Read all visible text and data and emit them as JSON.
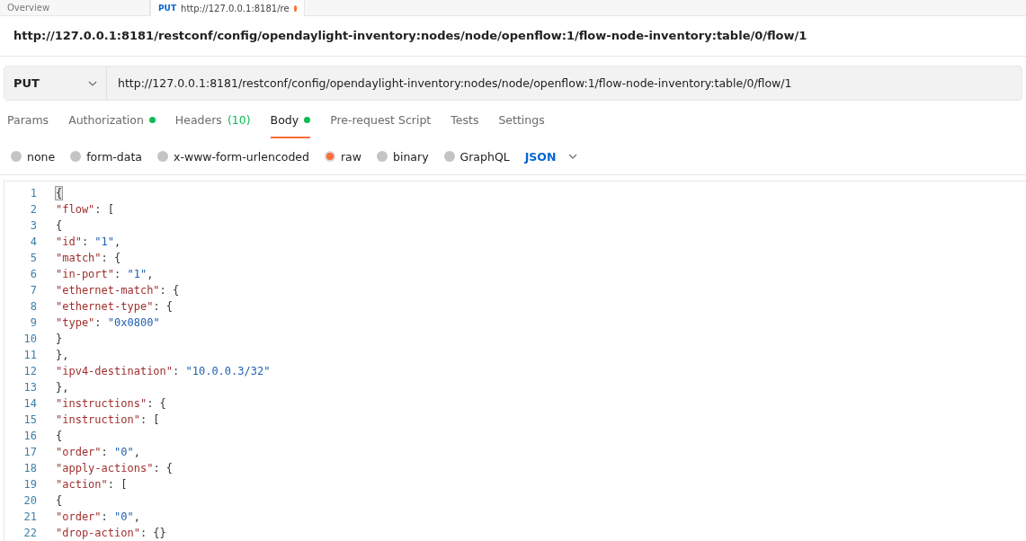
{
  "top_tabs": [
    {
      "label": "Overview",
      "selected": false,
      "unsaved": false
    },
    {
      "label": "http://127.0.0.1:8181/re",
      "method": "PUT",
      "selected": true,
      "unsaved": true
    }
  ],
  "request_title": "http://127.0.0.1:8181/restconf/config/opendaylight-inventory:nodes/node/openflow:1/flow-node-inventory:table/0/flow/1",
  "request_bar": {
    "method": "PUT",
    "url": "http://127.0.0.1:8181/restconf/config/opendaylight-inventory:nodes/node/openflow:1/flow-node-inventory:table/0/flow/1"
  },
  "tabs": [
    {
      "label": "Params",
      "selected": false,
      "dot": false
    },
    {
      "label": "Authorization",
      "selected": false,
      "dot": true
    },
    {
      "label": "Headers",
      "count": "(10)",
      "selected": false,
      "dot": false
    },
    {
      "label": "Body",
      "selected": true,
      "dot": true
    },
    {
      "label": "Pre-request Script",
      "selected": false,
      "dot": false
    },
    {
      "label": "Tests",
      "selected": false,
      "dot": false
    },
    {
      "label": "Settings",
      "selected": false,
      "dot": false
    }
  ],
  "body_types": [
    {
      "label": "none",
      "selected": false
    },
    {
      "label": "form-data",
      "selected": false
    },
    {
      "label": "x-www-form-urlencoded",
      "selected": false
    },
    {
      "label": "raw",
      "selected": true
    },
    {
      "label": "binary",
      "selected": false
    },
    {
      "label": "GraphQL",
      "selected": false
    }
  ],
  "format": "JSON",
  "editor_lines": [
    {
      "number": "1",
      "tokens": [
        {
          "kind": "punct",
          "text": "{",
          "match": true
        }
      ]
    },
    {
      "number": "2",
      "tokens": [
        {
          "kind": "key",
          "text": "\"flow\""
        },
        {
          "kind": "punct",
          "text": ": ["
        }
      ]
    },
    {
      "number": "3",
      "tokens": [
        {
          "kind": "punct",
          "text": "{"
        }
      ]
    },
    {
      "number": "4",
      "tokens": [
        {
          "kind": "key",
          "text": "\"id\""
        },
        {
          "kind": "punct",
          "text": ": "
        },
        {
          "kind": "string",
          "text": "\"1\""
        },
        {
          "kind": "punct",
          "text": ","
        }
      ]
    },
    {
      "number": "5",
      "tokens": [
        {
          "kind": "key",
          "text": "\"match\""
        },
        {
          "kind": "punct",
          "text": ": {"
        }
      ]
    },
    {
      "number": "6",
      "tokens": [
        {
          "kind": "key",
          "text": "\"in-port\""
        },
        {
          "kind": "punct",
          "text": ": "
        },
        {
          "kind": "string",
          "text": "\"1\""
        },
        {
          "kind": "punct",
          "text": ","
        }
      ]
    },
    {
      "number": "7",
      "tokens": [
        {
          "kind": "key",
          "text": "\"ethernet-match\""
        },
        {
          "kind": "punct",
          "text": ": {"
        }
      ]
    },
    {
      "number": "8",
      "tokens": [
        {
          "kind": "key",
          "text": "\"ethernet-type\""
        },
        {
          "kind": "punct",
          "text": ": {"
        }
      ]
    },
    {
      "number": "9",
      "tokens": [
        {
          "kind": "key",
          "text": "\"type\""
        },
        {
          "kind": "punct",
          "text": ": "
        },
        {
          "kind": "string",
          "text": "\"0x0800\""
        }
      ]
    },
    {
      "number": "10",
      "tokens": [
        {
          "kind": "punct",
          "text": "}"
        }
      ]
    },
    {
      "number": "11",
      "tokens": [
        {
          "kind": "punct",
          "text": "},"
        }
      ]
    },
    {
      "number": "12",
      "tokens": [
        {
          "kind": "key",
          "text": "\"ipv4-destination\""
        },
        {
          "kind": "punct",
          "text": ": "
        },
        {
          "kind": "string",
          "text": "\"10.0.0.3/32\""
        }
      ]
    },
    {
      "number": "13",
      "tokens": [
        {
          "kind": "punct",
          "text": "},"
        }
      ]
    },
    {
      "number": "14",
      "tokens": [
        {
          "kind": "key",
          "text": "\"instructions\""
        },
        {
          "kind": "punct",
          "text": ": {"
        }
      ]
    },
    {
      "number": "15",
      "tokens": [
        {
          "kind": "key",
          "text": "\"instruction\""
        },
        {
          "kind": "punct",
          "text": ": ["
        }
      ]
    },
    {
      "number": "16",
      "tokens": [
        {
          "kind": "punct",
          "text": "{"
        }
      ]
    },
    {
      "number": "17",
      "tokens": [
        {
          "kind": "key",
          "text": "\"order\""
        },
        {
          "kind": "punct",
          "text": ": "
        },
        {
          "kind": "string",
          "text": "\"0\""
        },
        {
          "kind": "punct",
          "text": ","
        }
      ]
    },
    {
      "number": "18",
      "tokens": [
        {
          "kind": "key",
          "text": "\"apply-actions\""
        },
        {
          "kind": "punct",
          "text": ": {"
        }
      ]
    },
    {
      "number": "19",
      "tokens": [
        {
          "kind": "key",
          "text": "\"action\""
        },
        {
          "kind": "punct",
          "text": ": ["
        }
      ]
    },
    {
      "number": "20",
      "tokens": [
        {
          "kind": "punct",
          "text": "{"
        }
      ]
    },
    {
      "number": "21",
      "tokens": [
        {
          "kind": "key",
          "text": "\"order\""
        },
        {
          "kind": "punct",
          "text": ": "
        },
        {
          "kind": "string",
          "text": "\"0\""
        },
        {
          "kind": "punct",
          "text": ","
        }
      ]
    },
    {
      "number": "22",
      "tokens": [
        {
          "kind": "key",
          "text": "\"drop-action\""
        },
        {
          "kind": "punct",
          "text": ": {}"
        }
      ]
    }
  ]
}
